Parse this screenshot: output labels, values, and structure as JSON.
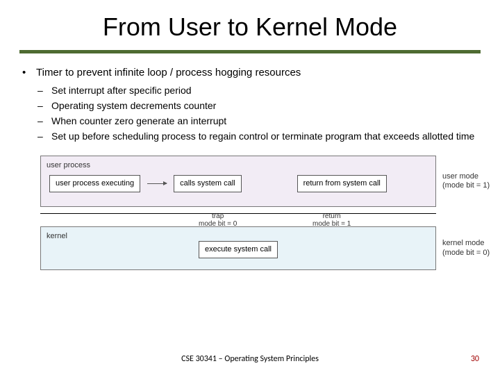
{
  "title": "From User to Kernel Mode",
  "bullet": "Timer to prevent infinite loop / process hogging resources",
  "subs": [
    "Set interrupt after specific period",
    "Operating system decrements counter",
    "When counter zero generate an interrupt",
    "Set up before scheduling process to regain control or terminate program that exceeds allotted time"
  ],
  "diagram": {
    "user_panel": "user process",
    "kernel_panel": "kernel",
    "box_exec": "user process executing",
    "box_call": "calls system call",
    "box_return": "return from system call",
    "box_execsys": "execute system call",
    "user_side_l1": "user mode",
    "user_side_l2": "(mode bit = 1)",
    "kernel_side_l1": "kernel mode",
    "kernel_side_l2": "(mode bit = 0)",
    "trap_l1": "trap",
    "trap_l2": "mode bit = 0",
    "return_l1": "return",
    "return_l2": "mode bit = 1"
  },
  "footer": {
    "center": "CSE 30341 – Operating System Principles",
    "page": "30"
  }
}
